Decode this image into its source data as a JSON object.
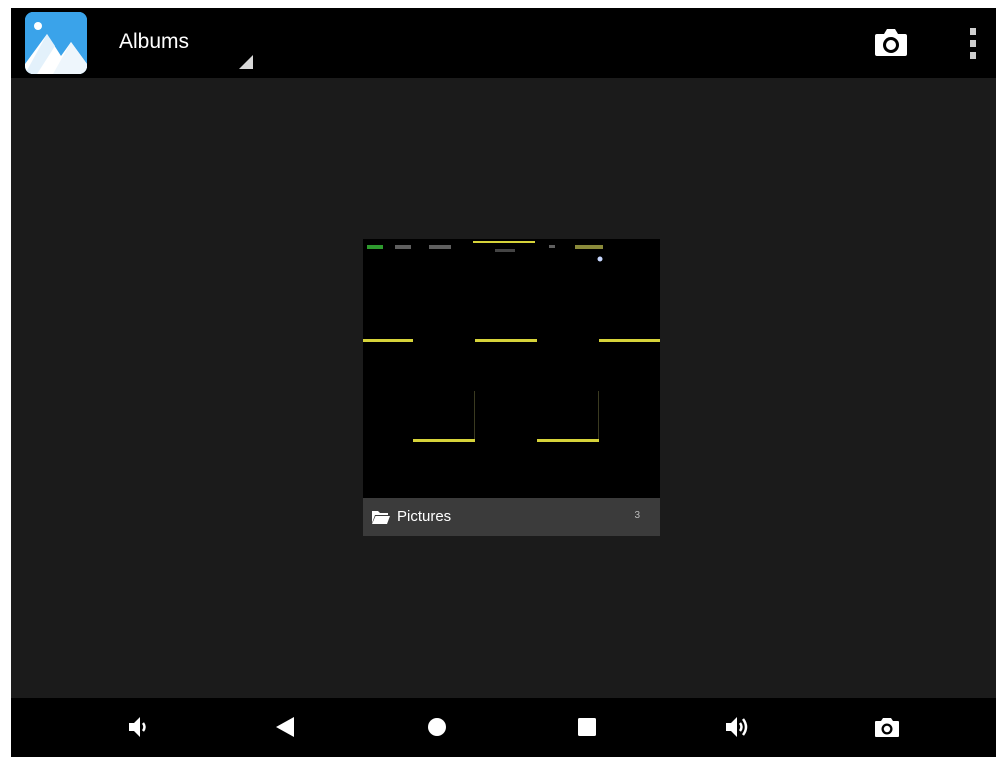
{
  "action_bar": {
    "app_icon": "gallery-icon",
    "spinner_label": "Albums",
    "spinner_icon": "dropdown-caret-icon",
    "actions": [
      {
        "name": "camera",
        "icon": "camera-icon"
      },
      {
        "name": "more-options",
        "icon": "overflow-menu-icon"
      }
    ]
  },
  "albums": [
    {
      "name": "Pictures",
      "count": "3",
      "icon": "folder-icon"
    }
  ],
  "nav_bar": {
    "buttons": [
      {
        "name": "volume-down",
        "icon": "volume-down-icon"
      },
      {
        "name": "back",
        "icon": "back-icon"
      },
      {
        "name": "home",
        "icon": "home-icon"
      },
      {
        "name": "recents",
        "icon": "recents-icon"
      },
      {
        "name": "volume-up",
        "icon": "volume-up-icon"
      },
      {
        "name": "screenshot",
        "icon": "camera-icon"
      }
    ]
  },
  "colors": {
    "background": "#1b1b1b",
    "bars": "#000000",
    "label_bar": "#3b3b3b",
    "app_icon_blue": "#3aa3ea",
    "trace_yellow": "#d6d33a"
  }
}
